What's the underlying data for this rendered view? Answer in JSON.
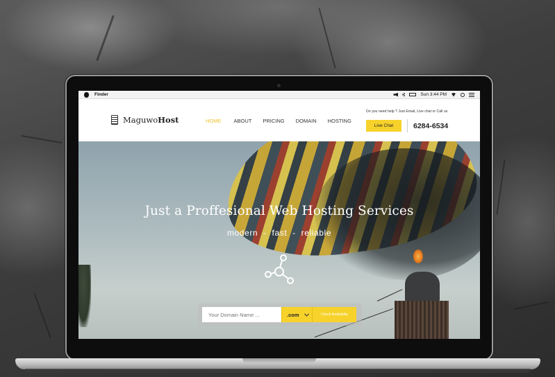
{
  "menubar": {
    "app_name": "Finder",
    "clock": "Sun 3:44 PM",
    "icons": [
      "apple-icon",
      "volume-icon",
      "bluetooth-icon",
      "battery-icon",
      "wifi-icon",
      "search-icon",
      "list-icon"
    ]
  },
  "header": {
    "logo_regular": "Maguwo",
    "logo_bold": "Host",
    "logo_icon": "server-icon",
    "nav": [
      "HOME",
      "ABOUT",
      "PRICING",
      "DOMAIN",
      "HOSTING"
    ],
    "active_nav": "HOME",
    "help_text": "Do you need help ? Just Email, Live chat or Call us",
    "live_chat_label": "Live Chat",
    "phone": "6284-6534"
  },
  "hero": {
    "title": "Just a Proffesional Web Hosting Services",
    "subtitle": "modern  -  fast  -  reliable",
    "icon": "network-icon"
  },
  "domain_search": {
    "placeholder": "Your Domain Name ...",
    "tld_selected": ".com",
    "check_label": "Check Availability"
  },
  "colors": {
    "accent": "#f7d22b",
    "active_nav": "#f2c12e",
    "text_dark": "#222222"
  }
}
